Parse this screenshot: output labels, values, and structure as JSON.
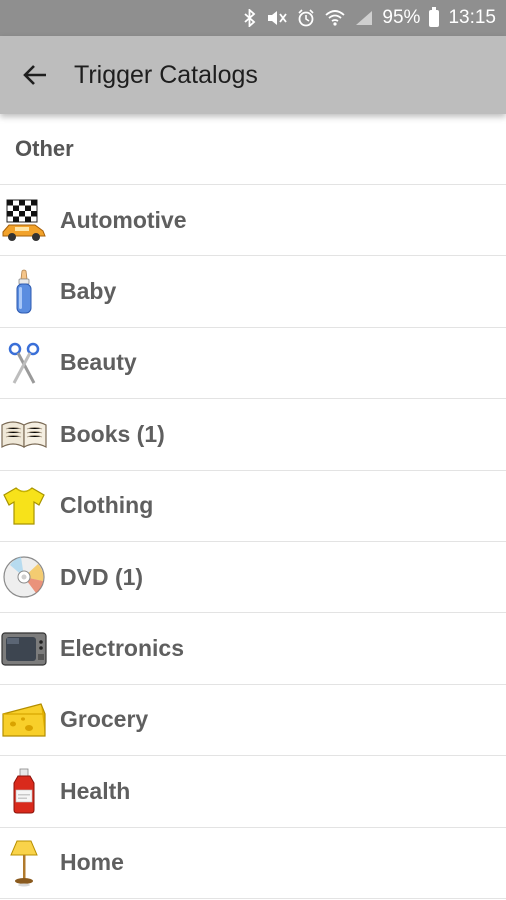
{
  "status": {
    "battery": "95%",
    "time": "13:15"
  },
  "appbar": {
    "title": "Trigger Catalogs"
  },
  "section_header": "Other",
  "items": [
    {
      "label": "Automotive",
      "icon": "checkered-flag-car-icon"
    },
    {
      "label": "Baby",
      "icon": "baby-bottle-icon"
    },
    {
      "label": "Beauty",
      "icon": "scissors-icon"
    },
    {
      "label": "Books (1)",
      "icon": "open-book-icon"
    },
    {
      "label": "Clothing",
      "icon": "tshirt-icon"
    },
    {
      "label": "DVD (1)",
      "icon": "disc-icon"
    },
    {
      "label": "Electronics",
      "icon": "tv-icon"
    },
    {
      "label": "Grocery",
      "icon": "cheese-icon"
    },
    {
      "label": "Health",
      "icon": "medicine-bottle-icon"
    },
    {
      "label": "Home",
      "icon": "lamp-icon"
    }
  ]
}
